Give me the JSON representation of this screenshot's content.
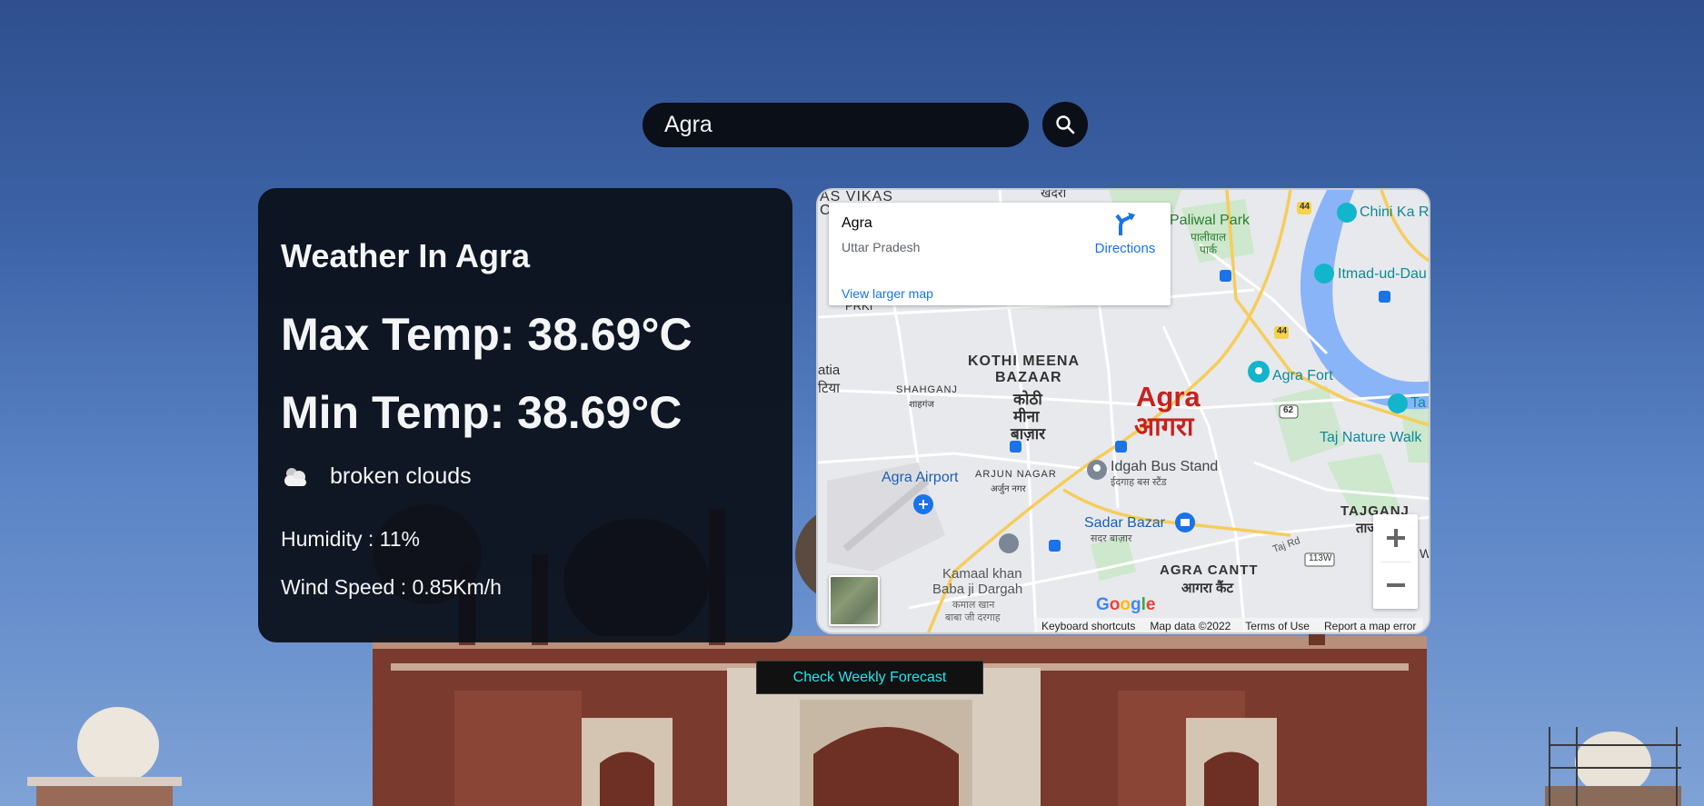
{
  "search": {
    "value": "Agra"
  },
  "icons": {
    "search": "search-icon",
    "weather": "broken-clouds-icon",
    "directions": "directions-icon",
    "zoom_in": "plus-icon",
    "zoom_out": "minus-icon"
  },
  "weather": {
    "title": "Weather In Agra",
    "max_temp": "Max Temp: 38.69°C",
    "min_temp": "Min Temp: 38.69°C",
    "description": "broken clouds",
    "humidity": "Humidity : 11%",
    "wind_speed": "Wind Speed : 0.85Km/h"
  },
  "map": {
    "info": {
      "place": "Agra",
      "region": "Uttar Pradesh",
      "directions": "Directions",
      "larger_map": "View larger map"
    },
    "labels": {
      "city_en": "Agra",
      "city_hi": "आगरा",
      "kothi_en": "KOTHI MEENA",
      "bazaar_en": "BAZAAR",
      "kothi_hi1": "कोठी",
      "kothi_hi2": "मीना",
      "kothi_hi3": "बाज़ार",
      "shahganj": "SHAHGANJ",
      "shahganj_hi": "शाहगंज",
      "airport": "Agra Airport",
      "arjun": "ARJUN NAGAR",
      "arjun_hi": "अर्जुन नगर",
      "idgah": "Idgah Bus Stand",
      "idgah_hi": "ईदगाह बस स्टैंड",
      "sadar": "Sadar Bazar",
      "sadar_hi": "सदर बाज़ार",
      "kamaal1": "Kamaal khan",
      "kamaal2": "Baba ji Dargah",
      "kamaal_hi1": "कमाल खान",
      "kamaal_hi2": "बाबा जी दरगाह",
      "agra_cantt": "AGRA CANTT",
      "agra_cantt_hi": "आगरा कैंट",
      "agra_fort": "Agra Fort",
      "taj_nature": "Taj Nature Walk",
      "tajganj": "TAJGANJ",
      "tajganj_hi": "ताज",
      "paliwal": "Paliwal Park",
      "paliwal_hi1": "पालीवाल",
      "paliwal_hi2": "पार्क",
      "chini": "Chini Ka R",
      "itmad": "Itmad-ud-Dau",
      "vikas": "AS VIKAS",
      "atia": "atia",
      "atia_hi": "टिया",
      "taj_rd": "Taj Rd",
      "route_44a": "44",
      "route_44b": "44",
      "route_62": "62",
      "route_113w": "113W",
      "ta": "Ta",
      "w": "W",
      "c": "C",
      "prk": "PRKI",
      "khdra": "खदरा"
    },
    "google": [
      "G",
      "o",
      "o",
      "g",
      "l",
      "e"
    ],
    "google_colors": [
      "#4285F4",
      "#EA4335",
      "#FBBC05",
      "#4285F4",
      "#34A853",
      "#EA4335"
    ],
    "attribution": {
      "keyboard": "Keyboard shortcuts",
      "data": "Map data ©2022",
      "terms": "Terms of Use",
      "report": "Report a map error"
    },
    "zoom_in": "+",
    "zoom_out": "−"
  },
  "forecast_button": "Check Weekly Forecast",
  "colors": {
    "card_bg": "#0a0e18",
    "accent_cyan": "#22e6ef",
    "map_blue": "#1a73e8",
    "city_red": "#c5221f"
  }
}
